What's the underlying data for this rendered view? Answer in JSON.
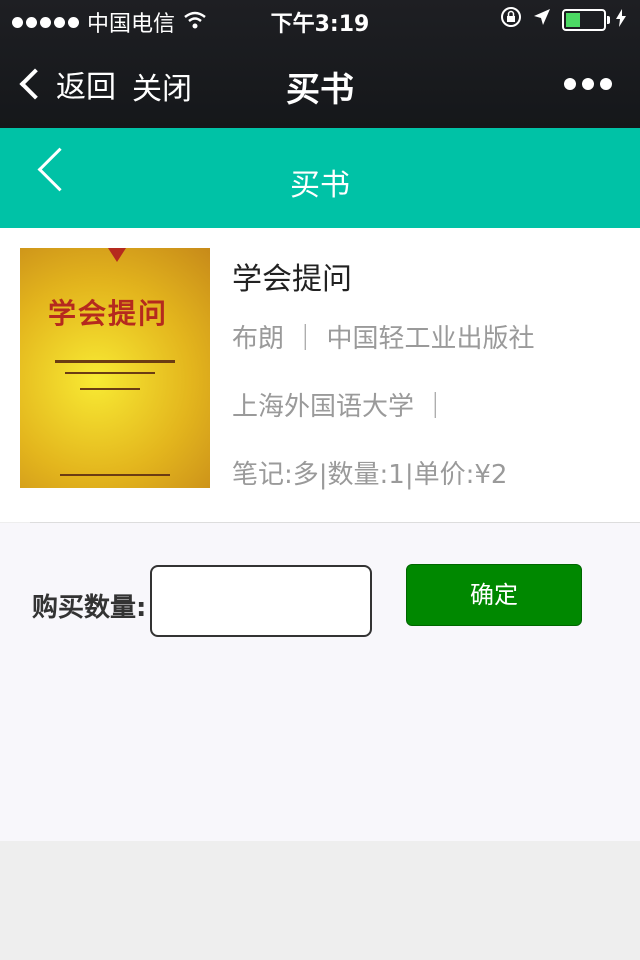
{
  "status": {
    "carrier": "中国电信",
    "time": "下午3:19"
  },
  "nav": {
    "back_label": "返回",
    "close_label": "关闭",
    "title": "买书"
  },
  "header": {
    "title": "买书"
  },
  "book": {
    "cover_title": "学会提问",
    "title": "学会提问",
    "line1": "布朗 ｜ 中国轻工业出版社",
    "line2": "上海外国语大学 ｜",
    "line3": "笔记:多|数量:1|单价:¥2"
  },
  "form": {
    "quantity_label": "购买数量:",
    "quantity_value": "",
    "confirm_label": "确定"
  },
  "colors": {
    "accent": "#00c2a6",
    "button": "#008800"
  }
}
